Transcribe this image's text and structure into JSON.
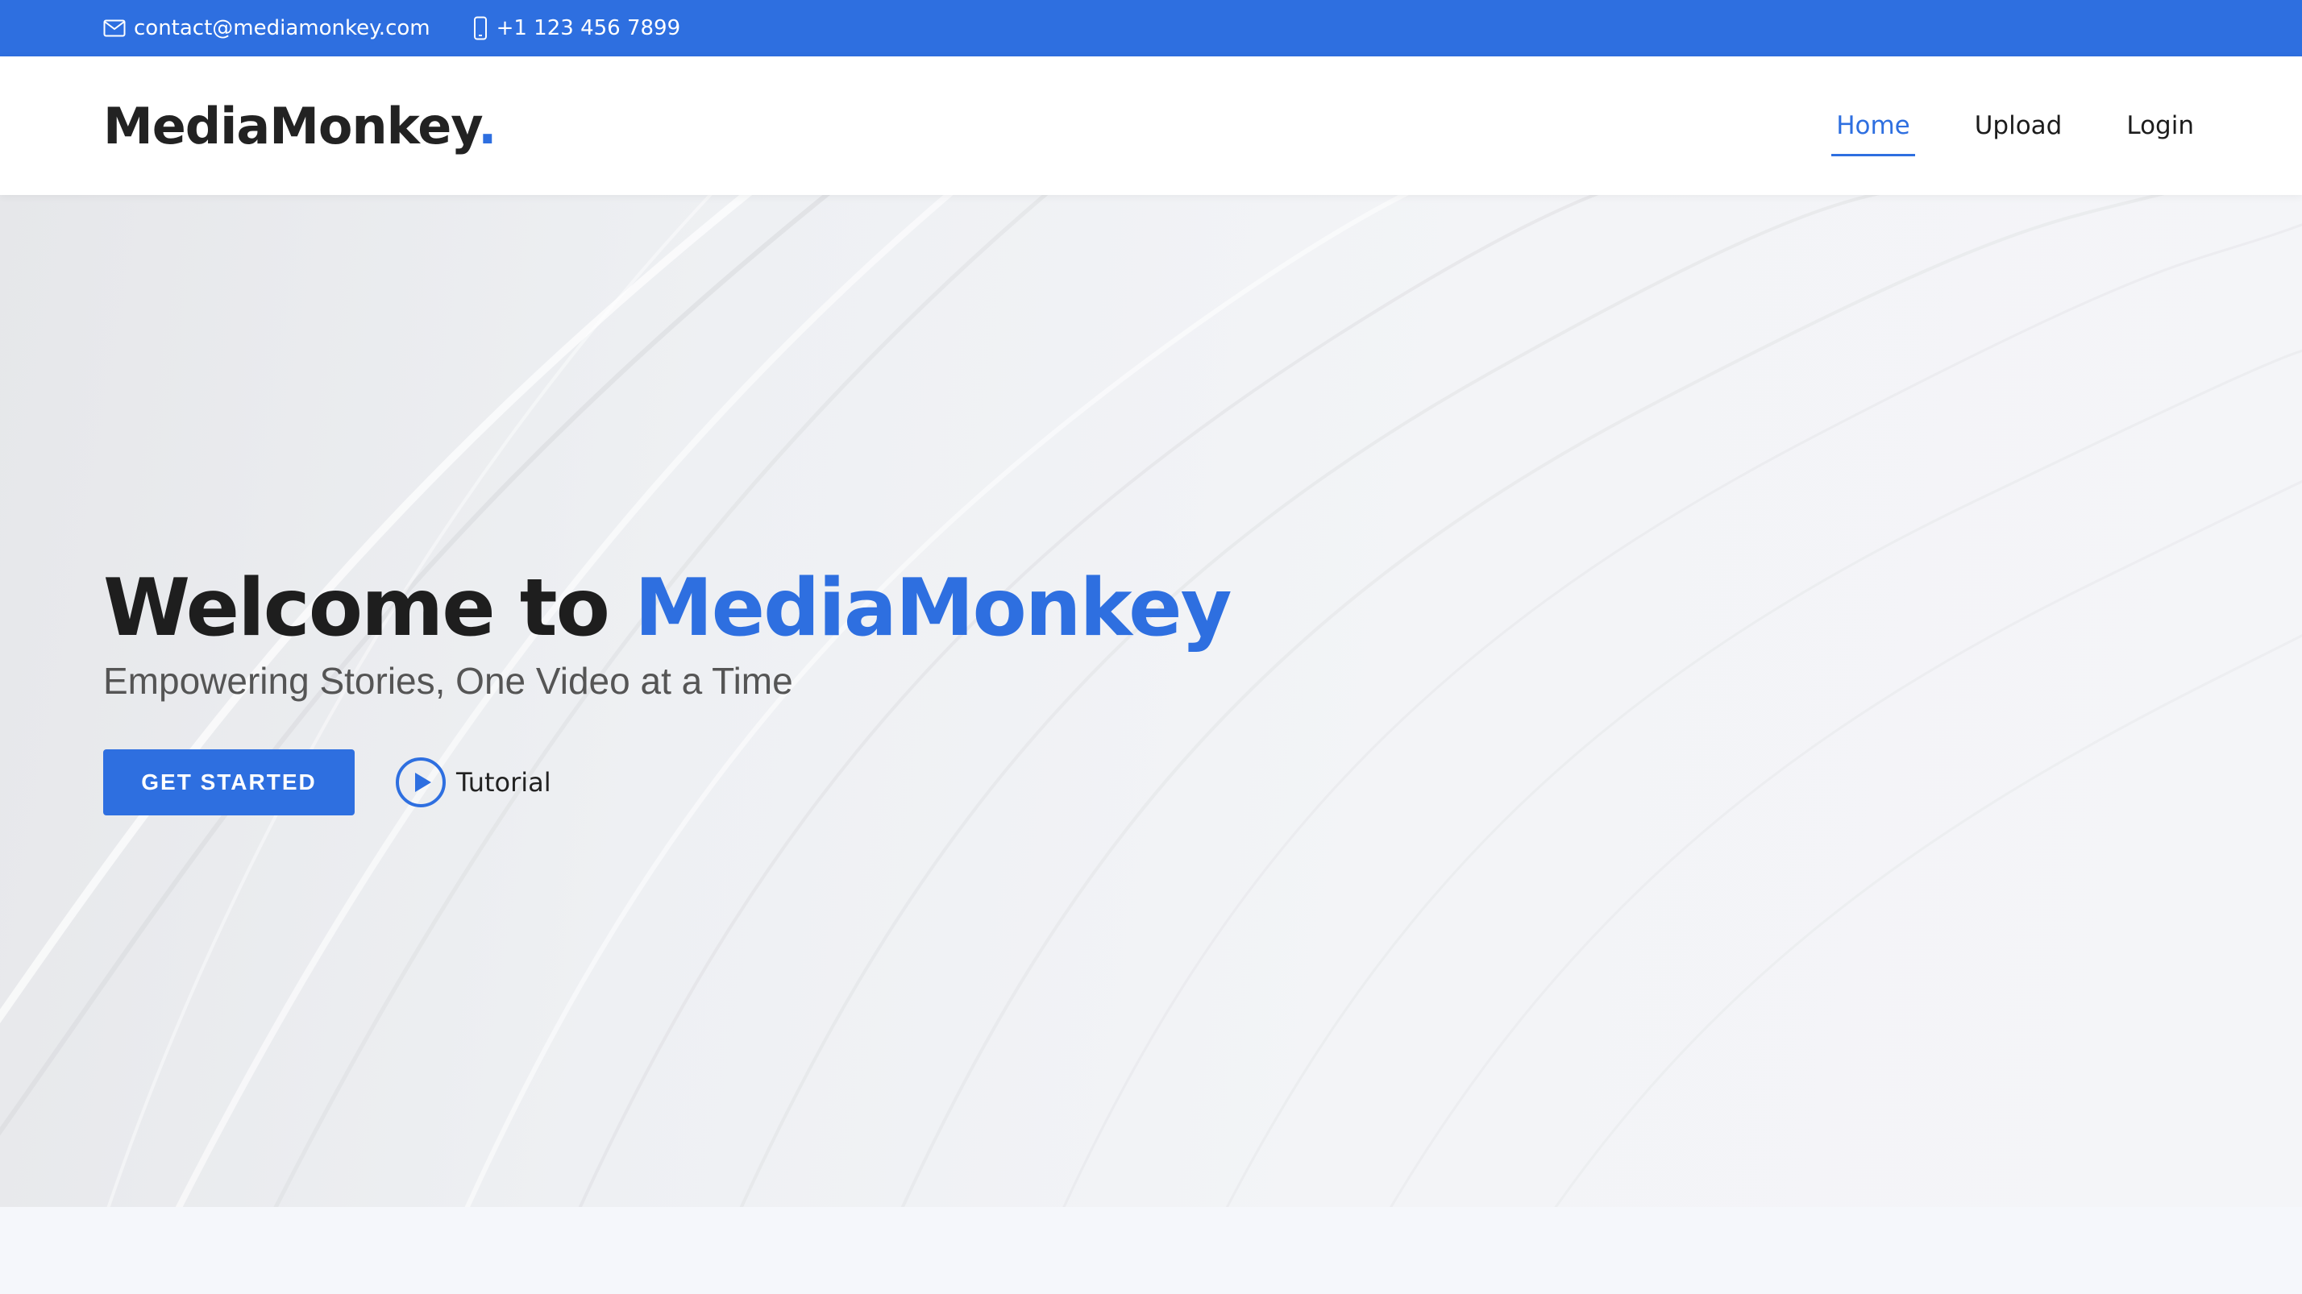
{
  "topbar": {
    "email": "contact@mediamonkey.com",
    "phone": "+1 123 456 7899",
    "email_icon": "envelope-icon",
    "phone_icon": "phone-icon"
  },
  "header": {
    "logo_text": "MediaMonkey",
    "logo_dot": "."
  },
  "nav": {
    "items": [
      {
        "label": "Home",
        "active": true
      },
      {
        "label": "Upload",
        "active": false
      },
      {
        "label": "Login",
        "active": false
      }
    ]
  },
  "hero": {
    "title_prefix": "Welcome to ",
    "title_accent": "MediaMonkey",
    "subtitle": "Empowering Stories, One Video at a Time",
    "cta_label": "GET STARTED",
    "tutorial_label": "Tutorial",
    "tutorial_icon": "play-circle-icon"
  },
  "colors": {
    "accent": "#2e6fe0",
    "text_dark": "#1e1e1e",
    "subtitle": "#555555"
  }
}
